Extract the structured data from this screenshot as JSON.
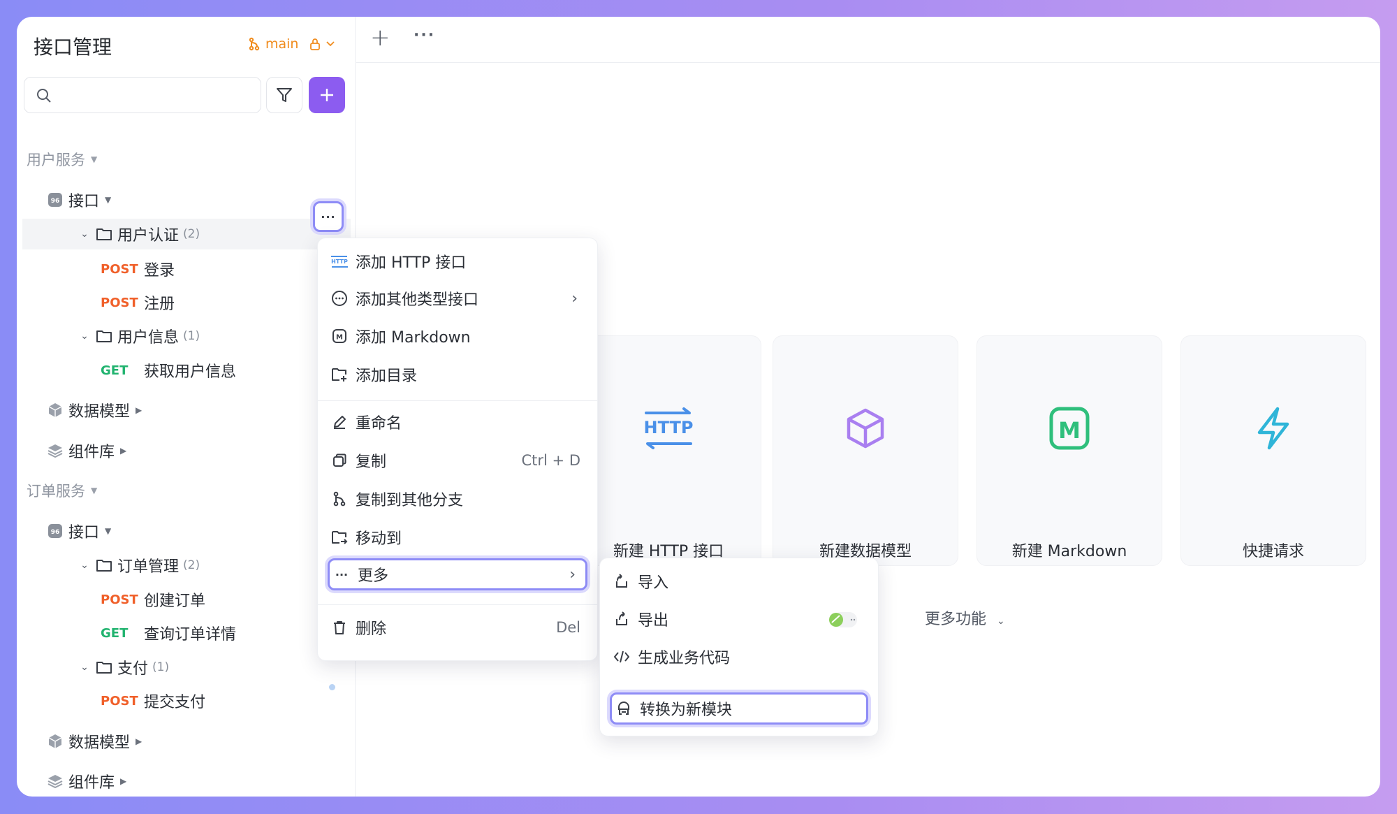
{
  "sidebar": {
    "title": "接口管理",
    "branch": "main",
    "search_placeholder": "",
    "groups": [
      {
        "label": "用户服务",
        "api_label": "接口",
        "folders": [
          {
            "name": "用户认证",
            "count": "(2)",
            "items": [
              {
                "method": "POST",
                "name": "登录"
              },
              {
                "method": "POST",
                "name": "注册"
              }
            ]
          },
          {
            "name": "用户信息",
            "count": "(1)",
            "items": [
              {
                "method": "GET",
                "name": "获取用户信息"
              }
            ]
          }
        ],
        "schemas_label": "数据模型",
        "components_label": "组件库"
      },
      {
        "label": "订单服务",
        "api_label": "接口",
        "folders": [
          {
            "name": "订单管理",
            "count": "(2)",
            "items": [
              {
                "method": "POST",
                "name": "创建订单"
              },
              {
                "method": "GET",
                "name": "查询订单详情"
              }
            ]
          },
          {
            "name": "支付",
            "count": "(1)",
            "items": [
              {
                "method": "POST",
                "name": "提交支付"
              }
            ]
          }
        ],
        "schemas_label": "数据模型",
        "components_label": "组件库"
      }
    ]
  },
  "topbar": {
    "add": "+",
    "more": "···"
  },
  "cards": [
    {
      "label": "新建 HTTP 接口",
      "icon": "http-icon",
      "icon_text": "HTTP"
    },
    {
      "label": "新建数据模型",
      "icon": "cube-icon"
    },
    {
      "label": "新建 Markdown",
      "icon": "markdown-icon",
      "icon_text": "M"
    },
    {
      "label": "快捷请求",
      "icon": "lightning-icon"
    }
  ],
  "more_features": "更多功能",
  "context_menu": {
    "items": [
      {
        "label": "添加 HTTP 接口",
        "icon": "http-icon",
        "icon_text": "HTTP"
      },
      {
        "label": "添加其他类型接口",
        "icon": "more-circle-icon"
      },
      {
        "label": "添加 Markdown",
        "icon": "markdown-icon",
        "icon_text": "M"
      },
      {
        "label": "添加目录",
        "icon": "folder-add-icon"
      },
      {
        "label": "重命名",
        "icon": "pencil-icon"
      },
      {
        "label": "复制",
        "icon": "copy-icon",
        "shortcut": "Ctrl + D"
      },
      {
        "label": "复制到其他分支",
        "icon": "branch-icon"
      },
      {
        "label": "移动到",
        "icon": "folder-move-icon"
      },
      {
        "label": "更多",
        "icon": "ellipsis-icon"
      },
      {
        "label": "删除",
        "icon": "trash-icon",
        "shortcut": "Del"
      }
    ]
  },
  "submenu": {
    "items": [
      {
        "label": "导入",
        "icon": "import-icon"
      },
      {
        "label": "导出",
        "icon": "export-icon"
      },
      {
        "label": "生成业务代码",
        "icon": "code-icon"
      },
      {
        "label": "转换为新模块",
        "icon": "module-icon"
      }
    ]
  },
  "colors": {
    "accent": "#8c5cf0",
    "post": "#f0602a",
    "get": "#21b36f",
    "branch": "#f08c1e",
    "highlight": "#8e8cf6"
  }
}
